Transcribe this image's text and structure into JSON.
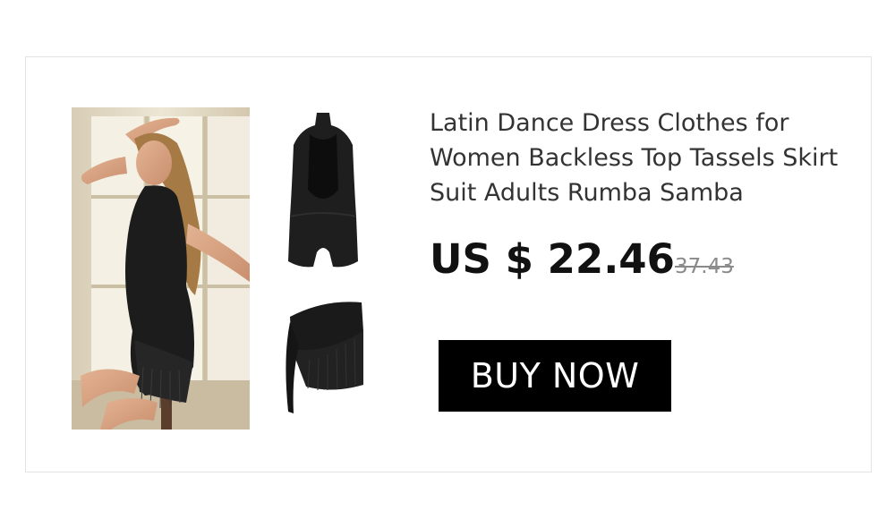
{
  "product": {
    "title": "Latin Dance Dress Clothes for Women Backless Top Tassels Skirt Suit Adults Rumba Samba",
    "price": "US $ 22.46",
    "original_price": "37.43",
    "buy_label": "BUY NOW"
  },
  "images": {
    "model": "model-photo",
    "bodysuit": "bodysuit-photo",
    "skirt": "tassel-skirt-photo"
  },
  "colors": {
    "button_bg": "#000000",
    "button_text": "#ffffff",
    "price": "#111111",
    "original_price": "#8a8a8a",
    "card_border": "#e3e3e3"
  }
}
